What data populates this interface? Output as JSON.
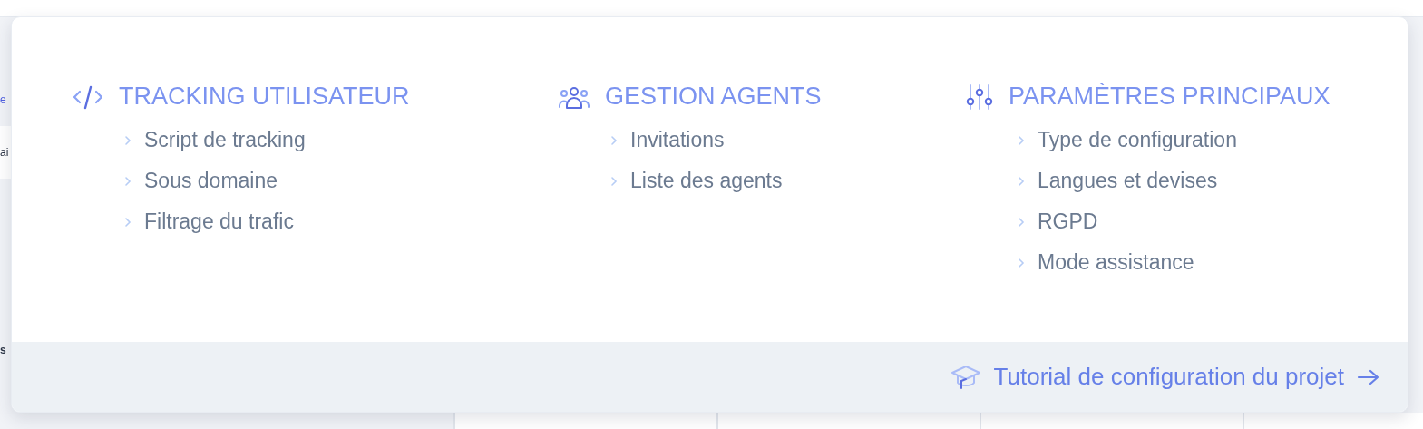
{
  "background": {
    "fragments": [
      {
        "kind": "link",
        "text": "e"
      },
      {
        "kind": "card",
        "text": "ai"
      },
      {
        "kind": "blank"
      },
      {
        "kind": "heading",
        "text": "s"
      }
    ]
  },
  "menu": {
    "columns": [
      {
        "title": "TRACKING UTILISATEUR",
        "items": [
          "Script de tracking",
          "Sous domaine",
          "Filtrage du trafic"
        ]
      },
      {
        "title": "GESTION AGENTS",
        "items": [
          "Invitations",
          "Liste des agents"
        ]
      },
      {
        "title": "PARAMÈTRES PRINCIPAUX",
        "items": [
          "Type de configuration",
          "Langues et devises",
          "RGPD",
          "Mode assistance"
        ]
      }
    ],
    "footer": {
      "link": "Tutorial de configuration du projet"
    }
  }
}
